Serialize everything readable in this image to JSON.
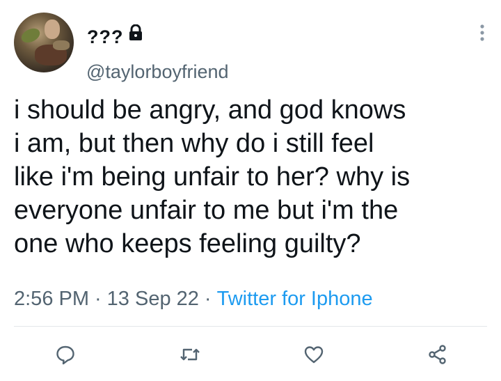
{
  "tweet": {
    "display_name": "???",
    "handle": "@taylorboyfriend",
    "text": "i should be angry, and god knows\ni am, but then why do i still feel\nlike i'm being unfair to her? why is\neveryone unfair to me but i'm the\none who keeps feeling guilty?",
    "time": "2:56 PM",
    "date": "13 Sep 22",
    "separator": "·",
    "source": "Twitter for Iphone"
  },
  "icons": {
    "account_locked": "lock-icon",
    "more": "more-vertical-icon",
    "reply": "reply-icon",
    "retweet": "retweet-icon",
    "like": "heart-icon",
    "share": "share-icon"
  },
  "colors": {
    "text": "#0f1419",
    "secondary": "#536471",
    "link": "#1d9bf0",
    "divider": "#e3e7ea"
  }
}
